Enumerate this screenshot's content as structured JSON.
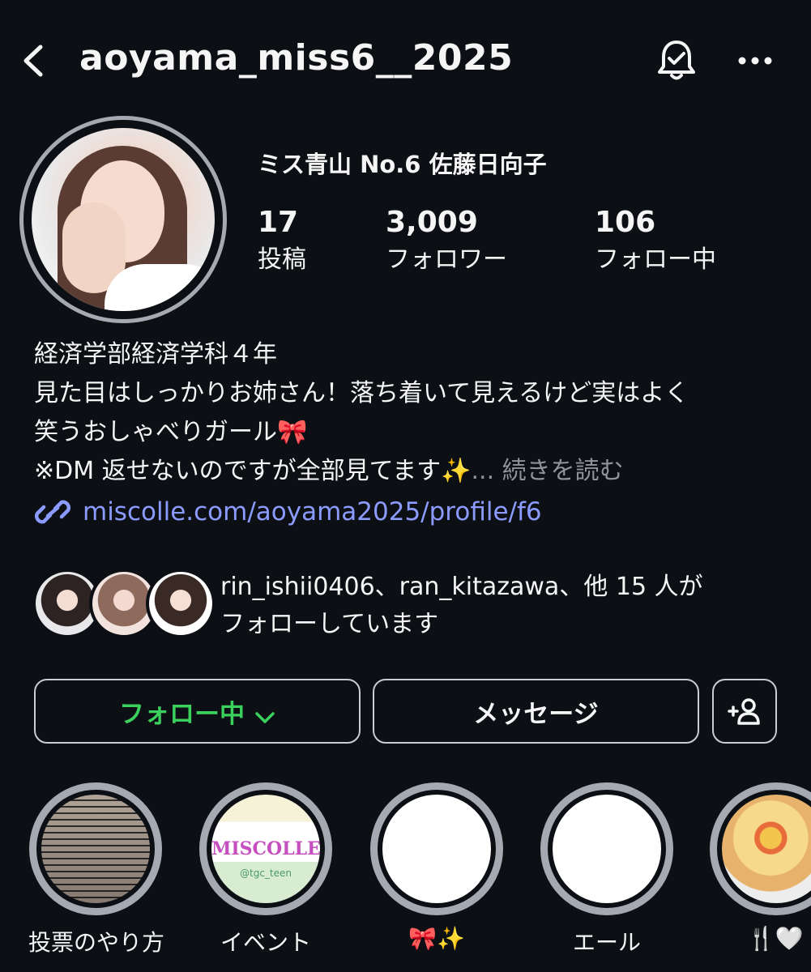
{
  "header": {
    "username": "aoyama_miss6__2025",
    "icons": [
      "back-icon",
      "bell-check-icon",
      "more-icon"
    ]
  },
  "profile": {
    "display_name": "ミス青山 No.6 佐藤日向子",
    "stats": [
      {
        "value": "17",
        "label": "投稿"
      },
      {
        "value": "3,009",
        "label": "フォロワー"
      },
      {
        "value": "106",
        "label": "フォロー中"
      }
    ],
    "bio": {
      "line1": "経済学部経済学科４年",
      "line2": "見た目はしっかりお姉さん！落ち着いて見えるけど実はよく",
      "line3": "笑うおしゃべりガール🎀",
      "line4": "※DM 返せないのですが全部見てます✨",
      "more": "... 続きを読む"
    },
    "link": "miscolle.com/aoyama2025/profile/f6"
  },
  "followed_by": {
    "line1": "rin_ishii0406、ran_kitazawa、他 15 人が",
    "line2": "フォローしています"
  },
  "actions": {
    "follow_label": "フォロー中",
    "message_label": "メッセージ"
  },
  "highlights": [
    {
      "label": "投票のやり方"
    },
    {
      "label": "イベント",
      "cover_text": "MISCOLLE",
      "cover_handle": "@tgc_teen"
    },
    {
      "label": "🎀✨"
    },
    {
      "label": "エール"
    },
    {
      "label": "🍴🤍"
    }
  ],
  "colors": {
    "background": "#0c0f14",
    "following_green": "#3bd15d",
    "link_blue": "#8c9bff",
    "ring_gray": "#a5a9b1"
  }
}
